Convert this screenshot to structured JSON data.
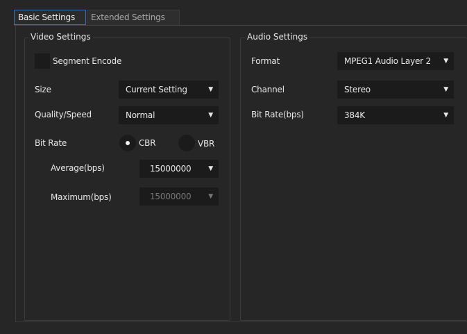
{
  "tabs": {
    "basic_label": "Basic Settings",
    "extended_label": "Extended Settings"
  },
  "video": {
    "legend": "Video Settings",
    "segment_encode_label": "Segment Encode",
    "segment_encode_checked": false,
    "size_label": "Size",
    "size_value": "Current Setting",
    "quality_label": "Quality/Speed",
    "quality_value": "Normal",
    "bitrate_label": "Bit Rate",
    "cbr_label": "CBR",
    "vbr_label": "VBR",
    "bitrate_mode_selected": "CBR",
    "average_label": "Average(bps)",
    "average_value": "15000000",
    "maximum_label": "Maximum(bps)",
    "maximum_value": "15000000"
  },
  "audio": {
    "legend": "Audio Settings",
    "format_label": "Format",
    "format_value": "MPEG1 Audio Layer 2",
    "channel_label": "Channel",
    "channel_value": "Stereo",
    "bitrate_label": "Bit Rate(bps)",
    "bitrate_value": "384K"
  },
  "icons": {
    "dropdown_arrow": "▼"
  },
  "colors": {
    "background": "#262626",
    "field": "#1b1b1b",
    "active_tab_border": "#3a6fb0",
    "text": "#e6e6e6",
    "disabled_text": "#777777"
  }
}
